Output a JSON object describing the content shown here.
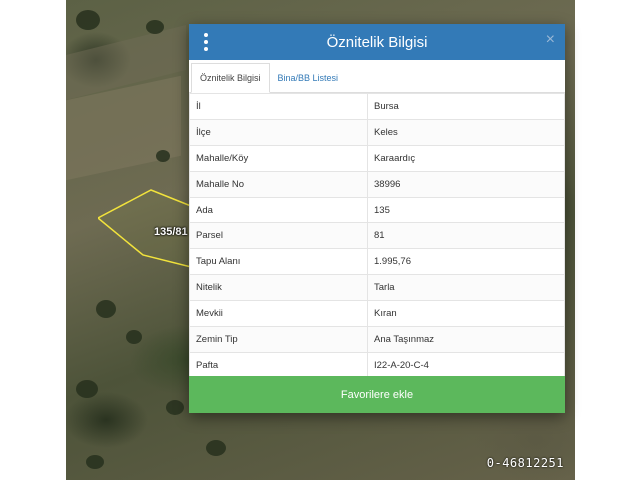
{
  "map": {
    "parcel_label": "135/81",
    "image_id_watermark": "0-46812251"
  },
  "dialog": {
    "title": "Öznitelik Bilgisi",
    "close_symbol": "×",
    "menu_icon": "vertical-dots-icon",
    "tabs": [
      {
        "label": "Öznitelik Bilgisi",
        "active": true
      },
      {
        "label": "Bina/BB Listesi",
        "active": false
      }
    ],
    "rows": [
      {
        "key": "İl",
        "value": "Bursa"
      },
      {
        "key": "İlçe",
        "value": "Keles"
      },
      {
        "key": "Mahalle/Köy",
        "value": "Karaardıç"
      },
      {
        "key": "Mahalle No",
        "value": "38996"
      },
      {
        "key": "Ada",
        "value": "135"
      },
      {
        "key": "Parsel",
        "value": "81"
      },
      {
        "key": "Tapu Alanı",
        "value": "1.995,76"
      },
      {
        "key": "Nitelik",
        "value": "Tarla"
      },
      {
        "key": "Mevkii",
        "value": "Kıran"
      },
      {
        "key": "Zemin Tip",
        "value": "Ana Taşınmaz"
      },
      {
        "key": "Pafta",
        "value": "I22-A-20-C-4"
      }
    ],
    "favorite_button": "Favorilere ekle"
  },
  "colors": {
    "header": "#337ab7",
    "favorite_button": "#5cb85c",
    "parcel_outline": "#f2e33c"
  }
}
